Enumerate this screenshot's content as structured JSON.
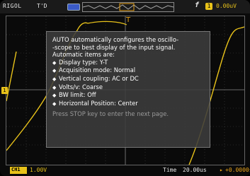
{
  "status": {
    "brand": "RIGOL",
    "trigger_state": "T'D",
    "trigger_slope_symbol": "f",
    "channel_badge": "1",
    "trigger_level": "0.00uV"
  },
  "help": {
    "intro": "AUTO automatically configures the oscillo-\n-scope  to  best display of the input signal.",
    "items_heading": "Automatic items are:",
    "items": [
      "Display type: Y-T",
      "Acquisition mode: Normal",
      "Vertical coupling: AC or DC",
      "Volts/v: Coarse",
      "BW limit: Off",
      "Horizontal Position: Center"
    ],
    "footer": "Press STOP key to enter the next page."
  },
  "bottom": {
    "ch1_label": "CH1",
    "ch1_scale": "1.00V",
    "time_label": "Time",
    "time_scale": "20.00us",
    "trig_offset": "+0.0000s"
  },
  "markers": {
    "ch1": "1",
    "trigger": "T"
  },
  "colors": {
    "ch1": "#e8c21a",
    "trigger": "#e8a31a",
    "grid": "#555555"
  }
}
